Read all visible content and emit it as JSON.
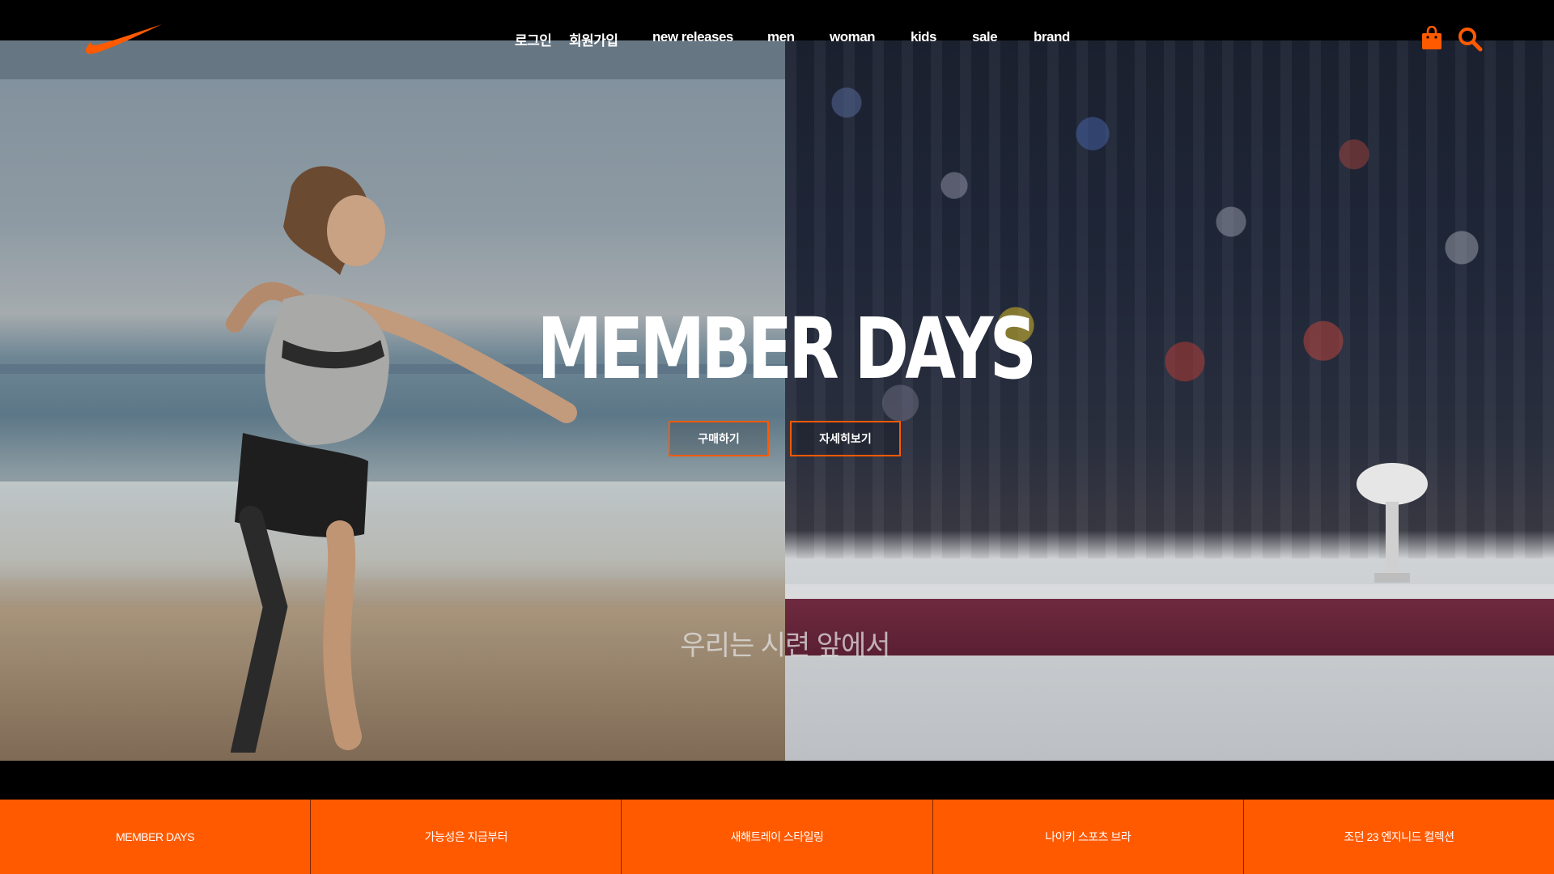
{
  "brand": {
    "logo_icon": "swoosh-logo-icon",
    "accent_color": "#ff5a00"
  },
  "nav": {
    "items": [
      {
        "label": "로그인"
      },
      {
        "label": "회원가입"
      },
      {
        "label": "new releases"
      },
      {
        "label": "men"
      },
      {
        "label": "woman"
      },
      {
        "label": "kids"
      },
      {
        "label": "sale"
      },
      {
        "label": "brand"
      }
    ],
    "icons": [
      "shopping-bag-icon",
      "search-icon"
    ]
  },
  "hero": {
    "title": "MEMBER DAYS",
    "buy_label": "구매하기",
    "more_label": "자세히보기",
    "subtitle": "우리는 시련 앞에서"
  },
  "tabs": [
    {
      "label": "MEMBER DAYS"
    },
    {
      "label": "가능성은 지금부터"
    },
    {
      "label": "새해트레이 스타일링"
    },
    {
      "label": "나이키 스포츠 브라"
    },
    {
      "label": "조던 23 엔지니드 컬렉션"
    }
  ]
}
